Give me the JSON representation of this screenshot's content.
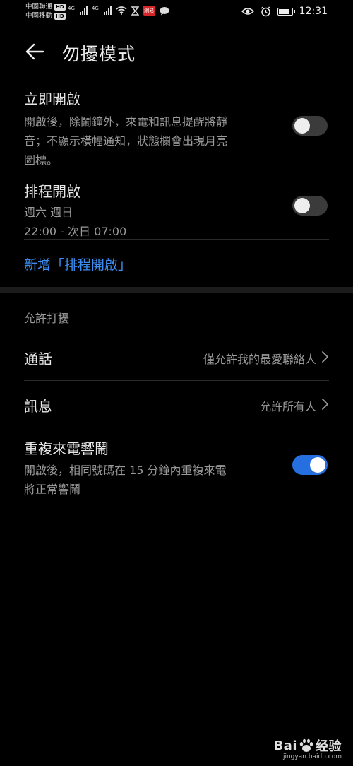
{
  "status_bar": {
    "carrier1": "中國聯通",
    "carrier2": "中國移動",
    "hd_badge": "HD",
    "network1": "4G",
    "network2": "4G",
    "app_badge": "網易",
    "time": "12:31",
    "battery_level": 0.8,
    "icons": [
      "signal-icon",
      "wifi-icon",
      "hourglass-icon",
      "chat-icon",
      "eye-icon",
      "alarm-icon",
      "battery-icon"
    ]
  },
  "header": {
    "title": "勿擾模式",
    "back_icon": "arrow-left-icon"
  },
  "immediate": {
    "title": "立即開啟",
    "desc_line1": "開啟後，除鬧鐘外，來電和訊息提醒將靜",
    "desc_line2": "音；不顯示橫幅通知，狀態欄會出現月亮",
    "desc_line3": "圖標。",
    "enabled": false
  },
  "schedule": {
    "title": "排程開啟",
    "days": "週六 週日",
    "time_range": "22:00 - 次日 07:00",
    "enabled": false
  },
  "add_schedule_link": "新增「排程開啟」",
  "allow_section": {
    "label": "允許打擾",
    "calls": {
      "label": "通話",
      "value": "僅允許我的最愛聯絡人"
    },
    "messages": {
      "label": "訊息",
      "value": "允許所有人"
    },
    "repeat_calls": {
      "title": "重複來電響鬧",
      "desc_line1": "開啟後，相同號碼在 15 分鐘內重複來電",
      "desc_line2": "將正常響鬧",
      "enabled": true
    }
  },
  "watermark": {
    "brand": "Bai",
    "brand_suffix": "经验",
    "url": "jingyan.baidu.com"
  },
  "colors": {
    "accent": "#3d8df0",
    "toggle_on": "#256fe0",
    "background": "#000000",
    "secondary_text": "#9a9a9a"
  }
}
